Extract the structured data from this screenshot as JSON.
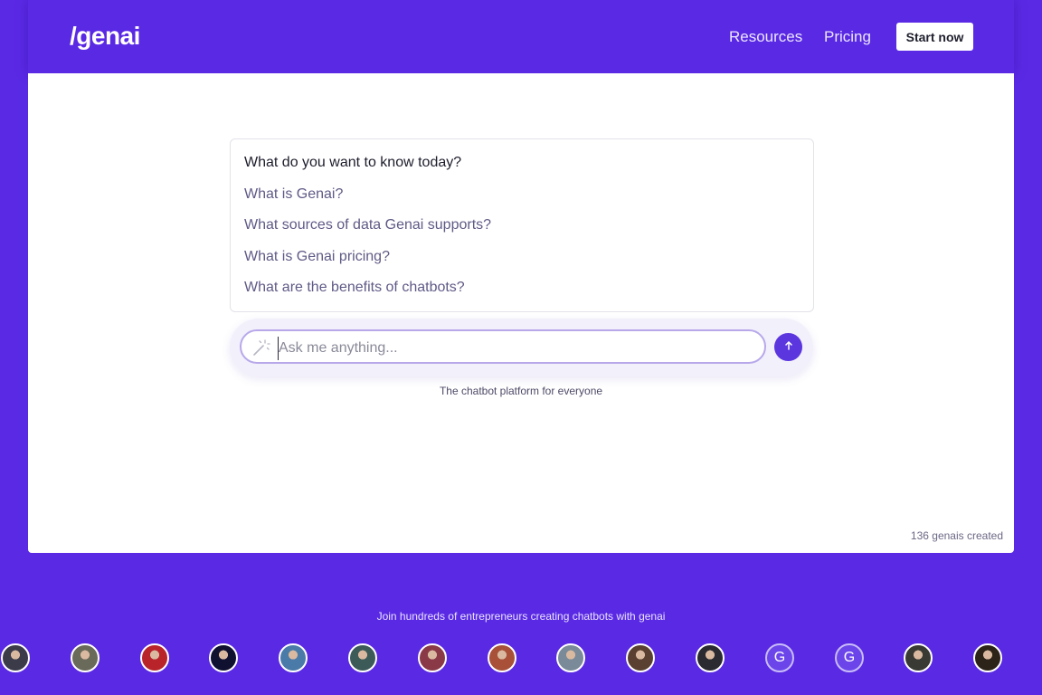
{
  "header": {
    "logo": "/genai",
    "nav": [
      {
        "label": "Resources"
      },
      {
        "label": "Pricing"
      }
    ],
    "cta_label": "Start now"
  },
  "suggestions": {
    "heading": "What do you want to know today?",
    "items": [
      "What is Genai?",
      "What sources of data Genai supports?",
      "What is Genai pricing?",
      "What are the benefits of chatbots?"
    ]
  },
  "chat": {
    "placeholder": "Ask me anything...",
    "value": "",
    "send_icon": "arrow-up-icon",
    "input_icon": "magic-wand-icon"
  },
  "tagline": "The chatbot platform for everyone",
  "created_count": "136 genais created",
  "community": {
    "join_text": "Join hundreds of entrepreneurs creating chatbots with genai",
    "avatars": [
      {
        "type": "photo",
        "color": "#3b3b4a"
      },
      {
        "type": "photo",
        "color": "#6a6a5a"
      },
      {
        "type": "photo",
        "color": "#b8242a"
      },
      {
        "type": "photo",
        "color": "#101030"
      },
      {
        "type": "photo",
        "color": "#4a7aa8"
      },
      {
        "type": "photo",
        "color": "#3c5a58"
      },
      {
        "type": "photo",
        "color": "#8a3a46"
      },
      {
        "type": "photo",
        "color": "#a85038"
      },
      {
        "type": "photo",
        "color": "#7a8a98"
      },
      {
        "type": "photo",
        "color": "#5a4030"
      },
      {
        "type": "photo",
        "color": "#2a2a30"
      },
      {
        "type": "letter",
        "letter": "G"
      },
      {
        "type": "letter",
        "letter": "G"
      },
      {
        "type": "photo",
        "color": "#3a3a34"
      },
      {
        "type": "photo",
        "color": "#2c2418"
      }
    ]
  },
  "colors": {
    "brand": "#5a29e4",
    "accent": "#5b35de",
    "suggestion_text": "#5f5a86"
  }
}
